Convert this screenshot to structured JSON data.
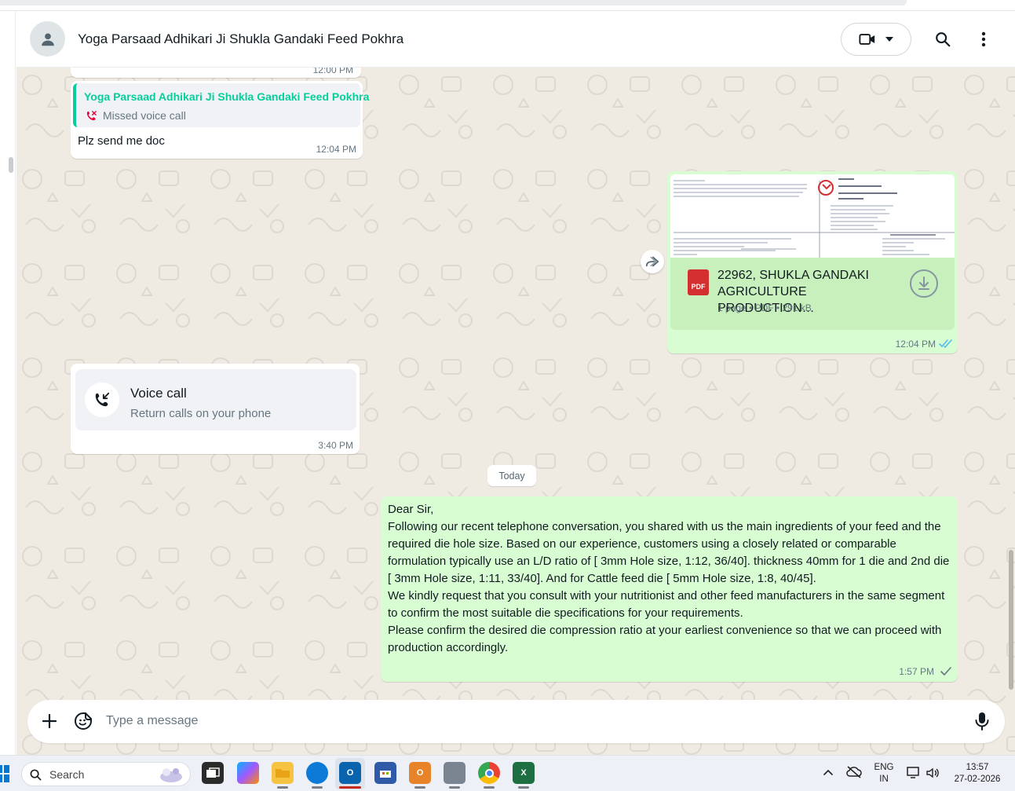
{
  "header": {
    "contact_name": "Yoga Parsaad Adhikari Ji Shukla Gandaki Feed Pokhra",
    "icons": [
      "avatar-person-icon",
      "video-call-icon",
      "chevron-down-icon",
      "search-icon",
      "more-options-icon"
    ]
  },
  "messages": {
    "m1": {
      "time": "12:00 PM"
    },
    "m2": {
      "quote_name": "Yoga Parsaad Adhikari Ji Shukla Gandaki Feed Pokhra",
      "quote_text": "Missed voice call",
      "text": "Plz send me doc",
      "time": "12:04 PM"
    },
    "m3": {
      "file_name": "22962, SHUKLA GANDAKI AGRICULTURE PRODUCTION…",
      "file_meta": "1 page • PDF • 291 kB",
      "file_type": "PDF",
      "time": "12:04 PM",
      "status": "read"
    },
    "m4": {
      "call_title": "Voice call",
      "call_sub": "Return calls on your phone",
      "time": "3:40 PM"
    },
    "date_divider": "Today",
    "m5": {
      "lines": [
        "Dear Sir,",
        "Following our recent telephone conversation, you  shared with us the main ingredients of your feed and the required die hole size. Based on our experience, customers using a closely related or comparable formulation typically use an L/D ratio of [  3mm Hole size, 1:12, 36/40]. thickness 40mm for 1 die and 2nd die [  3mm Hole size, 1:11, 33/40]. And for Cattle feed die  [  5mm Hole size, 1:8, 40/45].",
        "We kindly request that you consult with your nutritionist and other feed manufacturers in the same segment to confirm the most suitable die specifications for your requirements.",
        "Please confirm the desired die compression ratio at your earliest convenience so that we can proceed with production accordingly."
      ],
      "time": "1:57 PM",
      "status": "sent"
    }
  },
  "pdf_preview": {
    "company": "LARK ENGINEERING COMPANY (INDIA) PVT.LTD",
    "doc_title": "Proforma Invoice"
  },
  "composer": {
    "placeholder": "Type a message"
  },
  "taskbar": {
    "search_label": "Search",
    "lang_top": "ENG",
    "lang_bottom": "IN",
    "clock_time": "13:57",
    "clock_date": "27-02-2026"
  },
  "colors": {
    "chat_bg": "#efeae2",
    "outgoing": "#d9fdd3",
    "incoming": "#ffffff",
    "accent": "#06cf9c",
    "missed": "#ea0038",
    "read_tick": "#53bdeb"
  }
}
